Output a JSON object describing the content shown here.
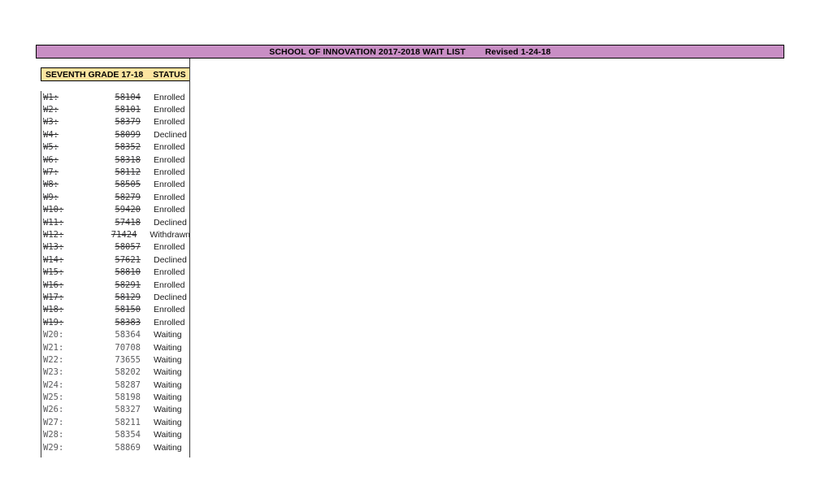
{
  "title_banner": {
    "text": "SCHOOL OF INNOVATION 2017-2018 WAIT LIST        Revised 1-24-18",
    "background_color": "#c88ec4",
    "border_color": "#000000"
  },
  "column_header": {
    "grade_label": "SEVENTH GRADE 17-18",
    "status_label": "STATUS",
    "background_color": "#fce5a0",
    "border_color": "#000000"
  },
  "table": {
    "columns": [
      "SEVENTH GRADE 17-18",
      "",
      "STATUS"
    ],
    "rows": [
      {
        "id": "W1:",
        "number": "58104",
        "status": "Enrolled",
        "struck": true
      },
      {
        "id": "W2:",
        "number": "58101",
        "status": "Enrolled",
        "struck": true
      },
      {
        "id": "W3:",
        "number": "58379",
        "status": "Enrolled",
        "struck": true
      },
      {
        "id": "W4:",
        "number": "58099",
        "status": "Declined",
        "struck": true
      },
      {
        "id": "W5:",
        "number": "58352",
        "status": "Enrolled",
        "struck": true
      },
      {
        "id": "W6:",
        "number": "58318",
        "status": "Enrolled",
        "struck": true
      },
      {
        "id": "W7:",
        "number": "58112",
        "status": "Enrolled",
        "struck": true
      },
      {
        "id": "W8:",
        "number": "58505",
        "status": "Enrolled",
        "struck": true
      },
      {
        "id": "W9:",
        "number": "58279",
        "status": "Enrolled",
        "struck": true
      },
      {
        "id": "W10:",
        "number": "59420",
        "status": "Enrolled",
        "struck": true
      },
      {
        "id": "W11:",
        "number": "57418",
        "status": "Declined",
        "struck": true
      },
      {
        "id": "W12:",
        "number": "71424",
        "status": "Withdrawn",
        "struck": true
      },
      {
        "id": "W13:",
        "number": "58057",
        "status": "Enrolled",
        "struck": true
      },
      {
        "id": "W14:",
        "number": "57621",
        "status": "Declined",
        "struck": true
      },
      {
        "id": "W15:",
        "number": "58810",
        "status": "Enrolled",
        "struck": true
      },
      {
        "id": "W16:",
        "number": "58291",
        "status": "Enrolled",
        "struck": true
      },
      {
        "id": "W17:",
        "number": "58129",
        "status": "Declined",
        "struck": true
      },
      {
        "id": "W18:",
        "number": "58150",
        "status": "Enrolled",
        "struck": true
      },
      {
        "id": "W19:",
        "number": "58383",
        "status": "Enrolled",
        "struck": true
      },
      {
        "id": "W20:",
        "number": "58364",
        "status": "Waiting",
        "struck": false
      },
      {
        "id": "W21:",
        "number": "70708",
        "status": "Waiting",
        "struck": false
      },
      {
        "id": "W22:",
        "number": "73655",
        "status": "Waiting",
        "struck": false
      },
      {
        "id": "W23:",
        "number": "58202",
        "status": "Waiting",
        "struck": false
      },
      {
        "id": "W24:",
        "number": "58287",
        "status": "Waiting",
        "struck": false
      },
      {
        "id": "W25:",
        "number": "58198",
        "status": "Waiting",
        "struck": false
      },
      {
        "id": "W26:",
        "number": "58327",
        "status": "Waiting",
        "struck": false
      },
      {
        "id": "W27:",
        "number": "58211",
        "status": "Waiting",
        "struck": false
      },
      {
        "id": "W28:",
        "number": "58354",
        "status": "Waiting",
        "struck": false
      },
      {
        "id": "W29:",
        "number": "58869",
        "status": "Waiting",
        "struck": false
      }
    ]
  }
}
